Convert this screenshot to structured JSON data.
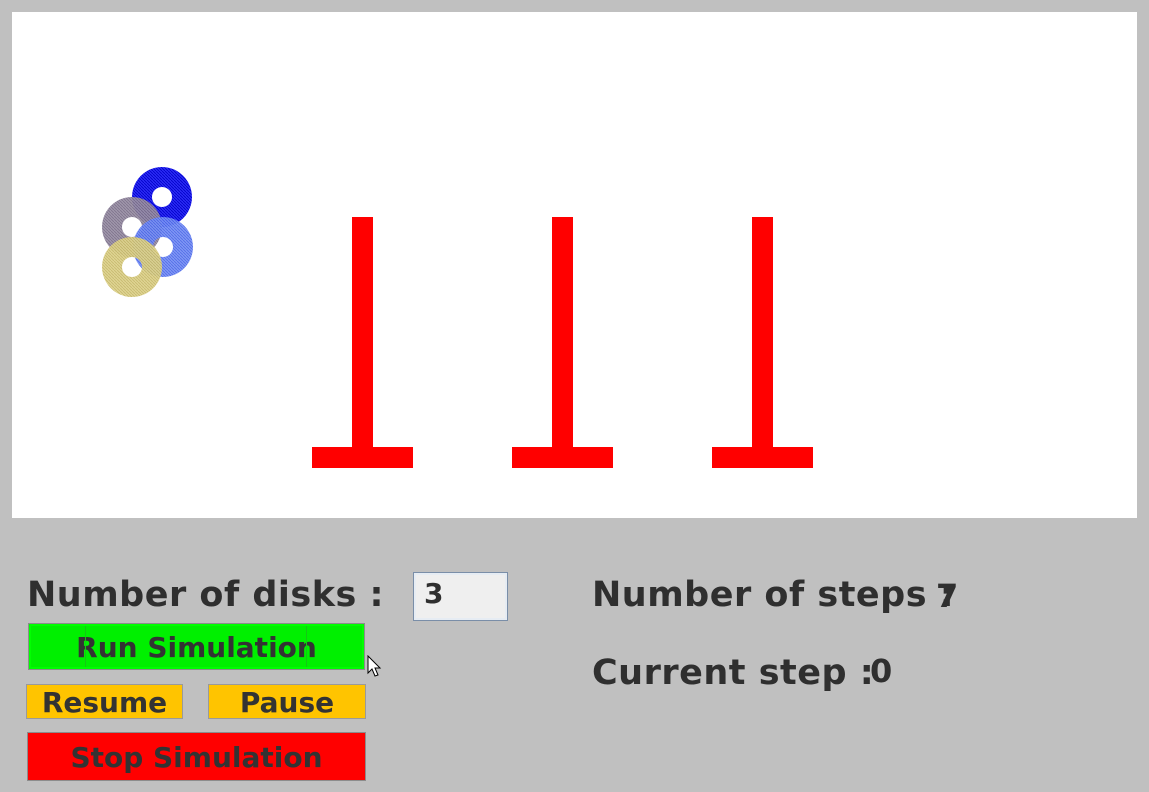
{
  "controls": {
    "disks_label": "Number of disks :",
    "disks_value": "3",
    "run_label": "Run Simulation",
    "resume_label": "Resume",
    "pause_label": "Pause",
    "stop_label": "Stop Simulation"
  },
  "status": {
    "steps_label": "Number of steps :",
    "steps_value": "7",
    "current_label": "Current step :",
    "current_value": "0"
  },
  "scene": {
    "background_color": "#ffffff",
    "peg_color": "#ff0000",
    "peg_count": 3,
    "disk_colors": [
      "#0000e6",
      "#8a7f96",
      "#5a78f0",
      "#d4c878"
    ]
  },
  "colors": {
    "panel_bg": "#c0c0c0",
    "run_button": "#00f000",
    "resume_pause_button": "#ffc400",
    "stop_button": "#ff0000"
  }
}
